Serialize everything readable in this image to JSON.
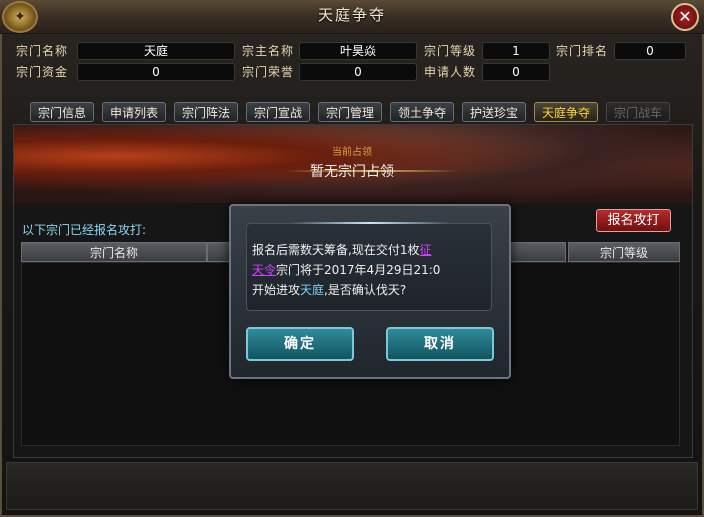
{
  "window": {
    "title": "天庭争夺",
    "close_icon_glyph": "✕"
  },
  "sect_info": {
    "name_label": "宗门名称",
    "name_value": "天庭",
    "leader_label": "宗主名称",
    "leader_value": "叶昊焱",
    "level_label": "宗门等级",
    "level_value": "1",
    "rank_label": "宗门排名",
    "rank_value": "0",
    "funds_label": "宗门资金",
    "funds_value": "0",
    "honor_label": "宗门荣誉",
    "honor_value": "0",
    "applicants_label": "申请人数",
    "applicants_value": "0"
  },
  "tabs": [
    {
      "label": "宗门信息",
      "state": "normal"
    },
    {
      "label": "申请列表",
      "state": "normal"
    },
    {
      "label": "宗门阵法",
      "state": "normal"
    },
    {
      "label": "宗门宣战",
      "state": "normal"
    },
    {
      "label": "宗门管理",
      "state": "normal"
    },
    {
      "label": "领土争夺",
      "state": "normal"
    },
    {
      "label": "护送珍宝",
      "state": "normal"
    },
    {
      "label": "天庭争夺",
      "state": "active"
    },
    {
      "label": "宗门战车",
      "state": "disabled"
    }
  ],
  "banner": {
    "occupant_label": "当前占领",
    "occupant_value": "暂无宗门占领"
  },
  "list": {
    "title": "以下宗门已经报名攻打:",
    "signup_button": "报名攻打",
    "columns": [
      "宗门名称",
      "宗门等级"
    ]
  },
  "dialog": {
    "text_1": "报名后需数天筹备,现在交付1枚",
    "item_name_a": "征",
    "item_name_b": "天令",
    "text_2": "宗门将于2017年4月29日21:0",
    "text_3": "开始进攻",
    "target": "天庭",
    "text_4": ",是否确认伐天?",
    "confirm_button": "确定",
    "cancel_button": "取消"
  },
  "colors": {
    "active_tab": "#ffd23a",
    "list_title": "#8ad8f0",
    "item_link": "#d040ff",
    "target_link": "#7ad0ff",
    "signup_button": "#b82a2a",
    "dialog_button": "#2f8a98"
  }
}
